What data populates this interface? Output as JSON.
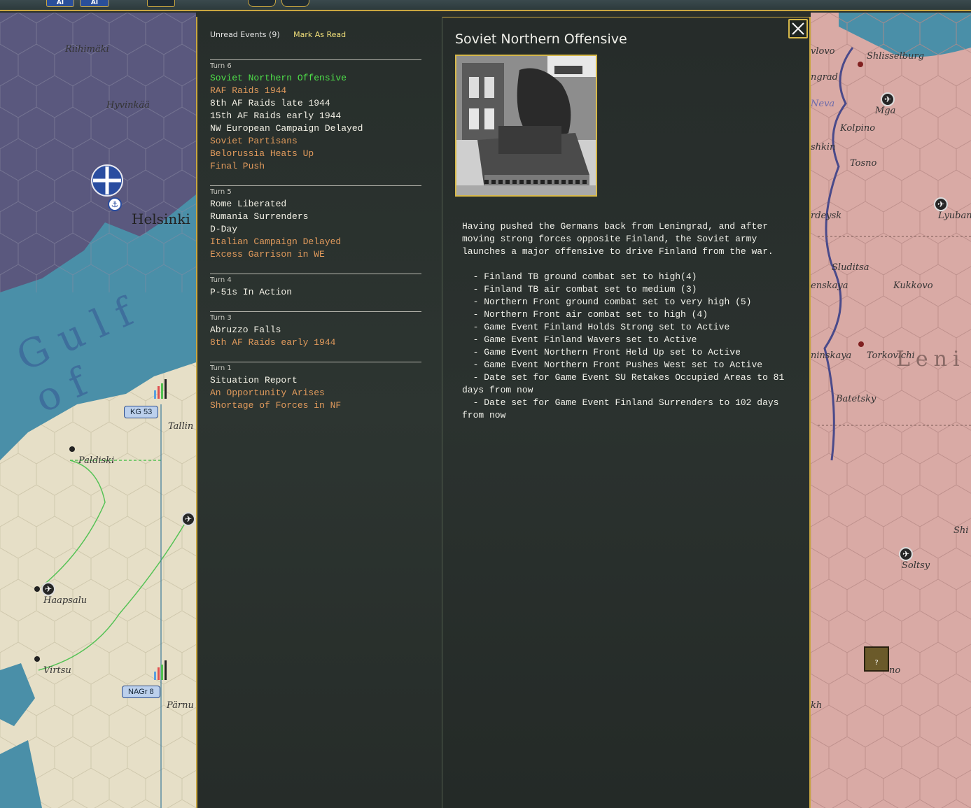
{
  "events_panel": {
    "unread_label": "Unread Events (9)",
    "mark_read_label": "Mark As Read",
    "turns": [
      {
        "label": "Turn 6",
        "events": [
          {
            "title": "Soviet Northern Offensive",
            "state": "selected"
          },
          {
            "title": "RAF Raids 1944",
            "state": "unread"
          },
          {
            "title": "8th AF Raids late 1944",
            "state": "read"
          },
          {
            "title": "15th AF Raids early 1944",
            "state": "read"
          },
          {
            "title": "NW European Campaign Delayed",
            "state": "read"
          },
          {
            "title": "Soviet Partisans",
            "state": "unread"
          },
          {
            "title": "Belorussia Heats Up",
            "state": "unread"
          },
          {
            "title": "Final Push",
            "state": "unread"
          }
        ]
      },
      {
        "label": "Turn 5",
        "events": [
          {
            "title": "Rome Liberated",
            "state": "read"
          },
          {
            "title": "Rumania Surrenders",
            "state": "read"
          },
          {
            "title": "D-Day",
            "state": "read"
          },
          {
            "title": "Italian Campaign Delayed",
            "state": "unread"
          },
          {
            "title": "Excess Garrison in WE",
            "state": "unread"
          }
        ]
      },
      {
        "label": "Turn 4",
        "events": [
          {
            "title": "P-51s In Action",
            "state": "read"
          }
        ]
      },
      {
        "label": "Turn 3",
        "events": [
          {
            "title": "Abruzzo Falls",
            "state": "read"
          },
          {
            "title": "8th AF Raids early 1944",
            "state": "unread"
          }
        ]
      },
      {
        "label": "Turn 1",
        "events": [
          {
            "title": "Situation Report",
            "state": "read"
          },
          {
            "title": "An Opportunity Arises",
            "state": "unread"
          },
          {
            "title": "Shortage of Forces in NF",
            "state": "unread"
          }
        ]
      }
    ]
  },
  "detail": {
    "title": "Soviet Northern Offensive",
    "close_icon": "close-icon",
    "body": "Having pushed the Germans back from Leningrad, and after\nmoving strong forces opposite Finland, the Soviet army\nlaunches a major offensive to drive Finland from the war.\n\n  - Finland TB ground combat set to high(4)\n  - Finland TB air combat set to medium (3)\n  - Northern Front ground combat set to very high (5)\n  - Northern Front air combat set to high (4)\n  - Game Event Finland Holds Strong set to Active\n  - Game Event Finland Wavers set to Active\n  - Game Event Northern Front Held Up set to Active\n  - Game Event Northern Front Pushes West set to Active\n  - Date set for Game Event SU Retakes Occupied Areas to 81\ndays from now\n  - Date set for Game Event Finland Surrenders to 102 days\nfrom now"
  },
  "toolbar": {
    "btn_a_label": "AI",
    "btn_b_label": "AI"
  },
  "map_left": {
    "gulf_label": "Gulf of",
    "places": [
      "Riihimäki",
      "Hyvinkää",
      "Helsinki",
      "Paldiski",
      "Tallin",
      "Haapsalu",
      "Virtsu",
      "Pärnu"
    ],
    "units": [
      "KG 53",
      "NAGr 8"
    ]
  },
  "map_right": {
    "places": [
      "vlovo",
      "Shlisselburg",
      "ngrad",
      "Neva",
      "Mga",
      "Kolpino",
      "shkin",
      "Tosno",
      "rdeysk",
      "Lyuban",
      "Sluditsa",
      "enskaya",
      "Kukkovo",
      "ninskaya",
      "Torkovichi",
      "Batetsky",
      "Soltsy",
      "kh",
      "no",
      "Shi",
      "Leni"
    ]
  },
  "colors": {
    "accent": "#c9a640",
    "selected_event": "#4fe04a",
    "unread_event": "#e09a5c",
    "read_event": "#f3f1e6",
    "link": "#f2e07a"
  }
}
